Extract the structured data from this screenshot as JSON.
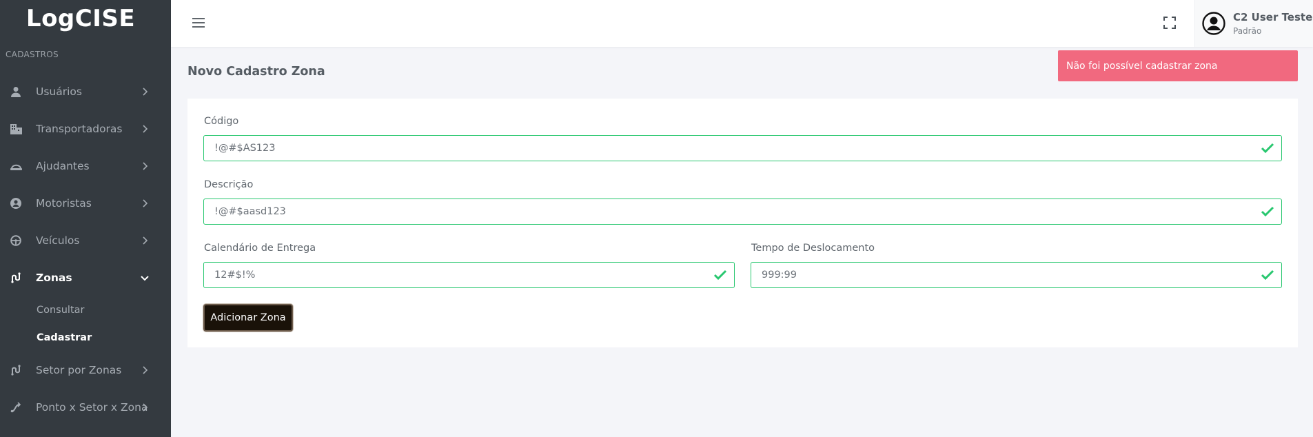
{
  "sidebar": {
    "brand": "LogCISE",
    "section_title": "CADASTROS",
    "items": [
      {
        "label": "Usuários",
        "icon": "user-icon"
      },
      {
        "label": "Transportadoras",
        "icon": "building-icon"
      },
      {
        "label": "Ajudantes",
        "icon": "helmet-icon"
      },
      {
        "label": "Motoristas",
        "icon": "user-circle-icon"
      },
      {
        "label": "Veículos",
        "icon": "steering-wheel-icon"
      },
      {
        "label": "Zonas",
        "icon": "route-icon",
        "active": true,
        "subitems": [
          {
            "label": "Consultar"
          },
          {
            "label": "Cadastrar",
            "active": true
          }
        ]
      },
      {
        "label": "Setor por Zonas",
        "icon": "route-icon"
      },
      {
        "label": "Ponto x Setor x Zona",
        "icon": "branch-icon"
      }
    ]
  },
  "topbar": {
    "user_name": "C2 User Teste",
    "user_role": "Padrão"
  },
  "page": {
    "title": "Novo Cadastro Zona",
    "alert": "Não foi possível cadastrar zona"
  },
  "form": {
    "codigo": {
      "label": "Código",
      "value": "!@#$AS123"
    },
    "descricao": {
      "label": "Descrição",
      "value": "!@#$aasd123"
    },
    "calendario": {
      "label": "Calendário de Entrega",
      "value": "12#$!%"
    },
    "tempo": {
      "label": "Tempo de Deslocamento",
      "value": "999:99"
    },
    "submit_label": "Adicionar Zona"
  },
  "colors": {
    "sidebar_bg": "#343a40",
    "valid_border": "#28c76f",
    "alert_bg": "#f1697f",
    "button_bg": "#1a1209"
  }
}
